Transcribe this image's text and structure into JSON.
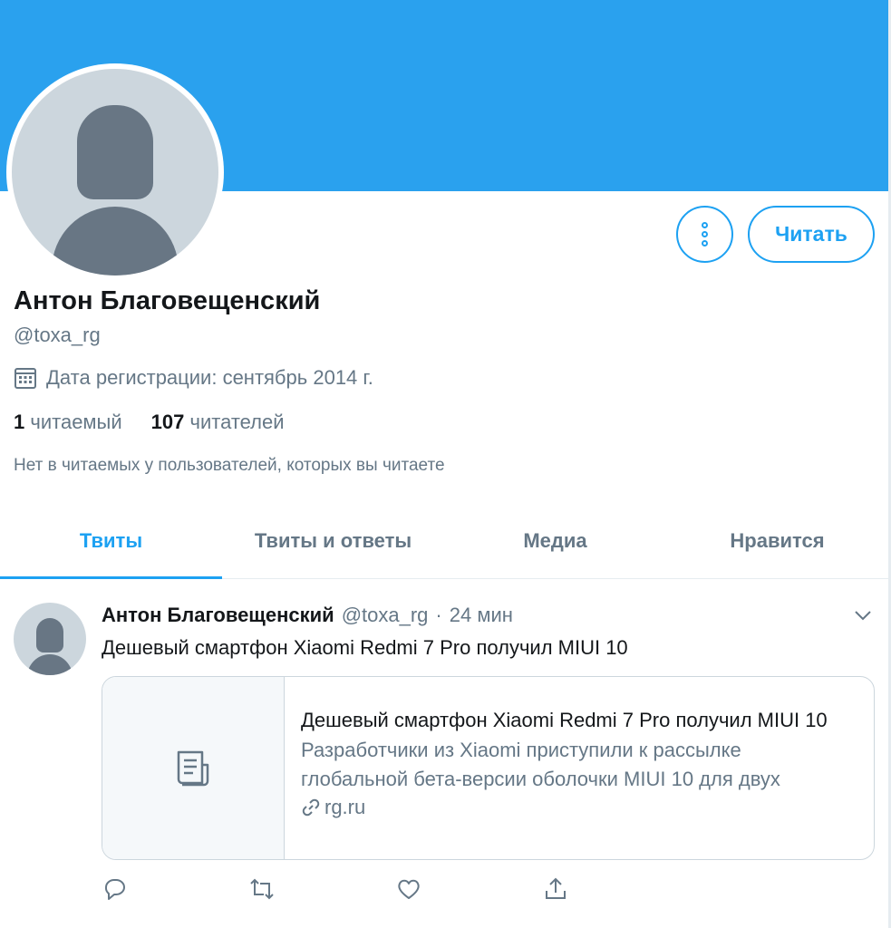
{
  "profile": {
    "name": "Антон Благовещенский",
    "handle": "@toxa_rg",
    "joined": "Дата регистрации: сентябрь 2014 г.",
    "following_count": "1",
    "following_label": "читаемый",
    "followers_count": "107",
    "followers_label": "читателей",
    "not_followed_text": "Нет в читаемых у пользователей, которых вы читаете"
  },
  "buttons": {
    "follow_label": "Читать"
  },
  "tabs": [
    {
      "label": "Твиты",
      "active": true
    },
    {
      "label": "Твиты и ответы",
      "active": false
    },
    {
      "label": "Медиа",
      "active": false
    },
    {
      "label": "Нравится",
      "active": false
    }
  ],
  "tweet": {
    "author": "Антон Благовещенский",
    "handle": "@toxa_rg",
    "separator": "·",
    "time": "24 мин",
    "text": "Дешевый смартфон Xiaomi Redmi 7 Pro получил MIUI 10",
    "card": {
      "title": "Дешевый смартфон Xiaomi Redmi 7 Pro получил MIUI 10",
      "desc_line1": "Разработчики из Xiaomi приступили к рассылке",
      "desc_line2": "глобальной бета-версии оболочки MIUI 10 для двух",
      "domain": "rg.ru"
    }
  },
  "icons": {
    "calendar": "calendar-icon",
    "more": "more-icon",
    "chevron": "chevron-down-icon",
    "article": "article-icon",
    "link": "link-icon",
    "reply": "reply-icon",
    "retweet": "retweet-icon",
    "like": "heart-icon",
    "share": "share-icon"
  },
  "colors": {
    "banner": "#2aa1ee",
    "accent": "#1da1f2",
    "secondary_text": "#657786"
  }
}
